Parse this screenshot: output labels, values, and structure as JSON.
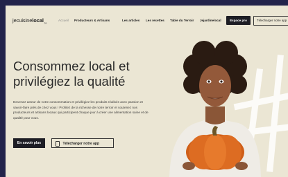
{
  "nav": {
    "logo_light": "jecuisine",
    "logo_bold": "local",
    "logo_suffix": ".be",
    "items": [
      "Accueil",
      "Producteurs & Artisans",
      "Les articles",
      "Les recettes",
      "Table du Terroir",
      "Jejardinelocal"
    ],
    "pro_label": "Espace pro",
    "download_label": "Télécharger notre app"
  },
  "hero": {
    "title_line1": "Consommez local et",
    "title_line2": "privilégiez la qualité",
    "description": "Devenez acteur de votre consommation et privilégiez les produits réalisés avec passion et savoir-faire près de chez vous ! Profitez de la richesse de notre terroir et soutenez nos producteurs et artisans locaux qui participent chaque jour à créer une alimentation saine et de qualité pour vous.",
    "cta_primary": "En savoir plus",
    "cta_secondary": "Télécharger notre app"
  },
  "colors": {
    "frame_bg": "#22234a",
    "page_bg": "#ebe6d4",
    "button_dark": "#1d1d24",
    "pumpkin": "#d9661e"
  }
}
